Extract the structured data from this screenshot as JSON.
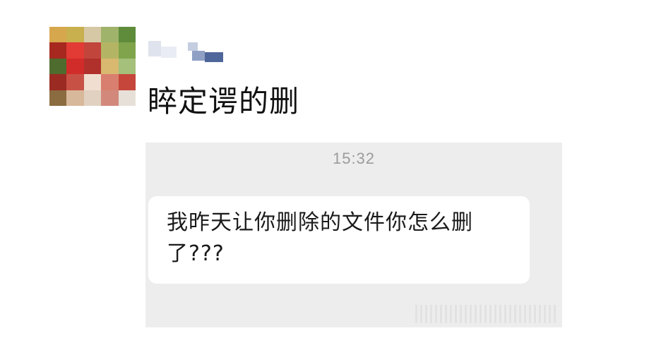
{
  "post": {
    "caption": "睟定谔的删"
  },
  "chat": {
    "timestamp": "15:32",
    "message": "我昨天让你删除的文件你怎么删了???"
  },
  "avatar": {
    "pixels": [
      "#d7a74d",
      "#c8b04f",
      "#d6c8a5",
      "#9fb36a",
      "#5e8c3b",
      "#a6281f",
      "#e23a34",
      "#c2453c",
      "#b4b564",
      "#7fa44b",
      "#4f6c2f",
      "#d12b2a",
      "#b0302c",
      "#d9b86f",
      "#a4c07a",
      "#9b2a22",
      "#c85146",
      "#f0dfd0",
      "#d97f6f",
      "#c7463b",
      "#8b6b40",
      "#d8b89a",
      "#e1d1c0",
      "#d2897b",
      "#e7e0d8"
    ]
  }
}
